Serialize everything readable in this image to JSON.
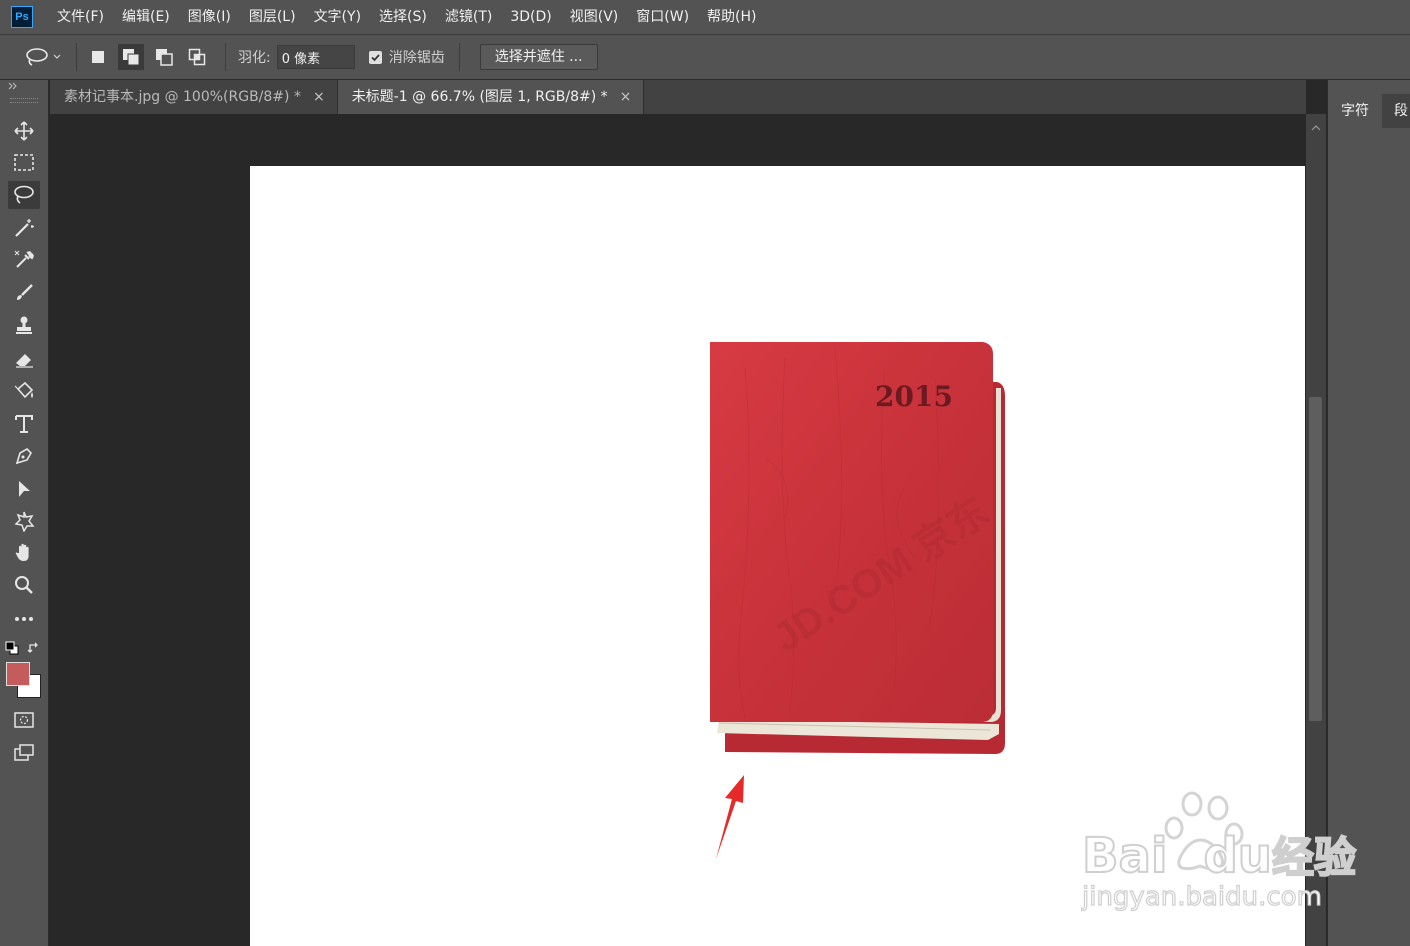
{
  "app": {
    "logo_text": "Ps"
  },
  "menu": [
    "文件(F)",
    "编辑(E)",
    "图像(I)",
    "图层(L)",
    "文字(Y)",
    "选择(S)",
    "滤镜(T)",
    "3D(D)",
    "视图(V)",
    "窗口(W)",
    "帮助(H)"
  ],
  "options": {
    "feather_label": "羽化:",
    "feather_value": "0 像素",
    "antialias_label": "消除锯齿",
    "antialias_checked": true,
    "refine_button": "选择并遮住 ..."
  },
  "tabs": [
    {
      "label": "素材记事本.jpg @ 100%(RGB/8#) *",
      "active": false,
      "close": "×"
    },
    {
      "label": "未标题-1 @ 66.7% (图层 1, RGB/8#) *",
      "active": true,
      "close": "×"
    }
  ],
  "panel": {
    "tabs": [
      "字符",
      "段"
    ]
  },
  "tools": [
    "move-icon",
    "marquee-icon",
    "lasso-icon",
    "magic-wand-icon",
    "eyedropper-icon",
    "brush-icon",
    "stamp-icon",
    "eraser-icon",
    "paint-bucket-icon",
    "type-icon",
    "pen-icon",
    "path-select-icon",
    "shape-icon",
    "hand-icon",
    "zoom-icon",
    "more-tools-icon"
  ],
  "colors": {
    "foreground": "#c45c5c",
    "background": "#ffffff",
    "accent": "#31a8ff",
    "book": "#c8323a",
    "arrow": "#e62a2a"
  },
  "canvas": {
    "book_year": "2015",
    "book_watermark": "JD.COM 京东"
  },
  "watermark": {
    "brand": "Bai",
    "brand2": "du",
    "cn": "经验",
    "url": "jingyan.baidu.com"
  }
}
